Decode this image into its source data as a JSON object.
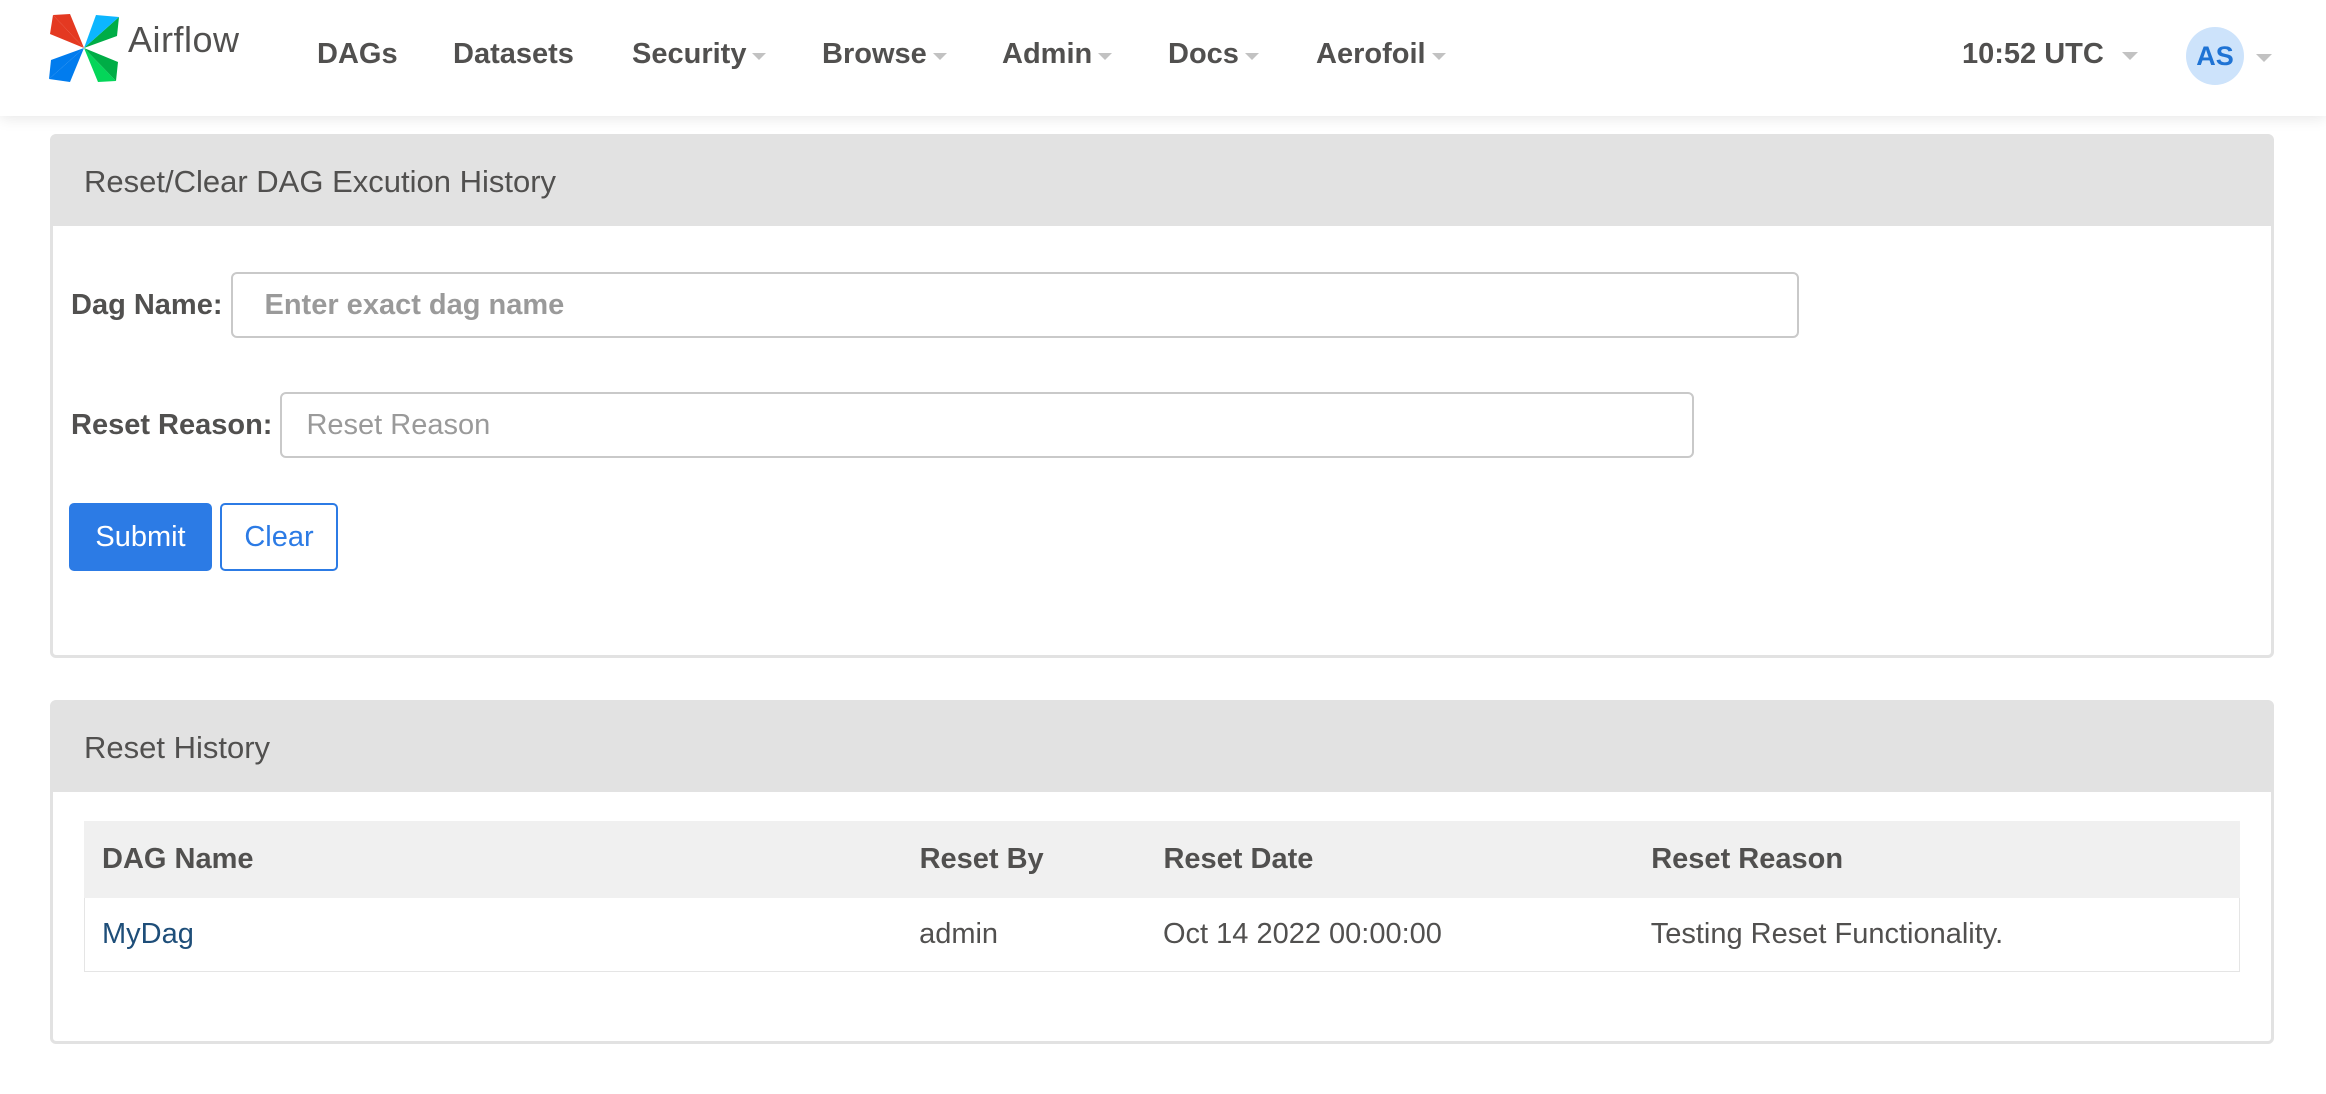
{
  "brand": {
    "name": "Airflow"
  },
  "nav": {
    "items": [
      {
        "label": "DAGs",
        "dropdown": false
      },
      {
        "label": "Datasets",
        "dropdown": false
      },
      {
        "label": "Security",
        "dropdown": true
      },
      {
        "label": "Browse",
        "dropdown": true
      },
      {
        "label": "Admin",
        "dropdown": true
      },
      {
        "label": "Docs",
        "dropdown": true
      },
      {
        "label": "Aerofoil",
        "dropdown": true
      }
    ],
    "clock": "10:52 UTC",
    "user_initials": "AS"
  },
  "reset_panel": {
    "title": "Reset/Clear DAG Excution History",
    "dag_name_label": "Dag Name:",
    "dag_name_placeholder": "Enter exact dag name",
    "dag_name_value": "",
    "reset_reason_label": "Reset Reason:",
    "reset_reason_placeholder": "Reset Reason",
    "reset_reason_value": "",
    "submit_label": "Submit",
    "clear_label": "Clear"
  },
  "history_panel": {
    "title": "Reset History",
    "columns": [
      "DAG Name",
      "Reset By",
      "Reset Date",
      "Reset Reason"
    ],
    "rows": [
      {
        "dag_name": "MyDag",
        "reset_by": "admin",
        "reset_date": "Oct 14 2022 00:00:00",
        "reset_reason": "Testing Reset Functionality."
      }
    ]
  },
  "colors": {
    "primary": "#2c7be5",
    "text": "#51504f",
    "panel_heading_bg": "#e2e2e2",
    "link": "#1e4e79",
    "avatar_bg": "#cde3fb"
  },
  "icons": {
    "logo": "airflow-pinwheel-logo-icon",
    "dropdown": "caret-down-icon"
  }
}
